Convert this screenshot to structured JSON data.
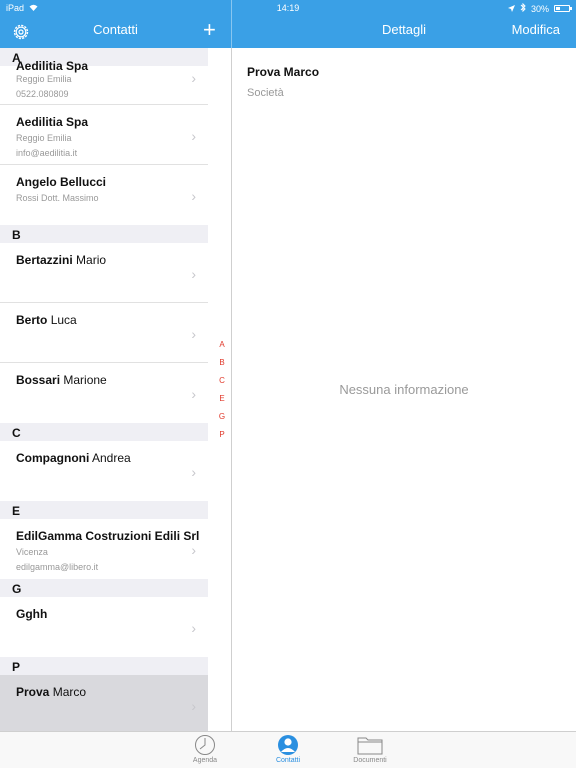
{
  "status": {
    "device": "iPad",
    "time": "14:19",
    "battery": "30%"
  },
  "header": {
    "left_title": "Contatti",
    "right_title": "Dettagli",
    "edit_label": "Modifica",
    "add_label": "+"
  },
  "contacts": {
    "sections": [
      {
        "letter": "A"
      },
      {
        "letter": "B"
      },
      {
        "letter": "C"
      },
      {
        "letter": "E"
      },
      {
        "letter": "G"
      },
      {
        "letter": "P"
      }
    ],
    "rows": [
      {
        "first": "Aedilitia Spa",
        "second": "",
        "line1": "Reggio Emilia",
        "line2": "0522.080809"
      },
      {
        "first": "Aedilitia Spa",
        "second": "",
        "line1": "Reggio Emilia",
        "line2": "info@aedilitia.it"
      },
      {
        "first": "Angelo Bellucci",
        "second": "",
        "line1": "Rossi Dott. Massimo",
        "line2": ""
      },
      {
        "first": "Bertazzini",
        "second": "Mario",
        "line1": "",
        "line2": ""
      },
      {
        "first": "Berto",
        "second": "Luca",
        "line1": "",
        "line2": ""
      },
      {
        "first": "Bossari",
        "second": "Marione",
        "line1": "",
        "line2": ""
      },
      {
        "first": "Compagnoni",
        "second": " Andrea",
        "line1": "",
        "line2": ""
      },
      {
        "first": "EdilGamma Costruzioni Edili Srl",
        "second": "",
        "line1": "Vicenza",
        "line2": "edilgamma@libero.it"
      },
      {
        "first": "Gghh",
        "second": "",
        "line1": "",
        "line2": ""
      },
      {
        "first": "Prova",
        "second": "Marco",
        "line1": "",
        "line2": ""
      }
    ]
  },
  "index": [
    "A",
    "B",
    "C",
    "E",
    "G",
    "P"
  ],
  "detail": {
    "name": "Prova Marco",
    "company_label": "Società",
    "empty_message": "Nessuna informazione"
  },
  "tabs": [
    {
      "label": "Agenda",
      "active": false
    },
    {
      "label": "Contatti",
      "active": true
    },
    {
      "label": "Documenti",
      "active": false
    }
  ],
  "colors": {
    "accent": "#3aa0e6",
    "index_red": "#e0382a",
    "selected_row": "#d9d9dd"
  }
}
